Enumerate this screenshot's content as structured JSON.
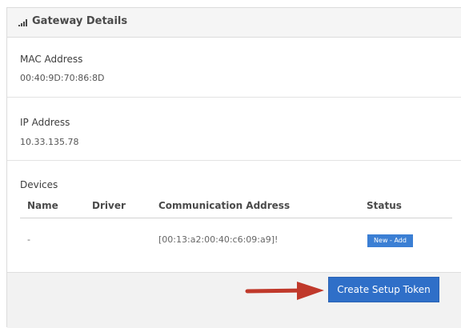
{
  "header": {
    "title": "Gateway Details",
    "icon": "signal-bars-icon"
  },
  "mac": {
    "label": "MAC Address",
    "value": "00:40:9D:70:86:8D"
  },
  "ip": {
    "label": "IP Address",
    "value": "10.33.135.78"
  },
  "devices": {
    "label": "Devices",
    "columns": [
      "Name",
      "Driver",
      "Communication Address",
      "Status"
    ],
    "rows": [
      {
        "name": "-",
        "driver": "",
        "communication_address": "[00:13:a2:00:40:c6:09:a9]!",
        "status": "New - Add"
      }
    ]
  },
  "footer": {
    "create_token_label": "Create Setup Token",
    "arrow_icon": "red-arrow-right-icon"
  },
  "colors": {
    "accent": "#2f6fc8",
    "badge": "#3b7fd4",
    "arrow": "#c0392b"
  }
}
